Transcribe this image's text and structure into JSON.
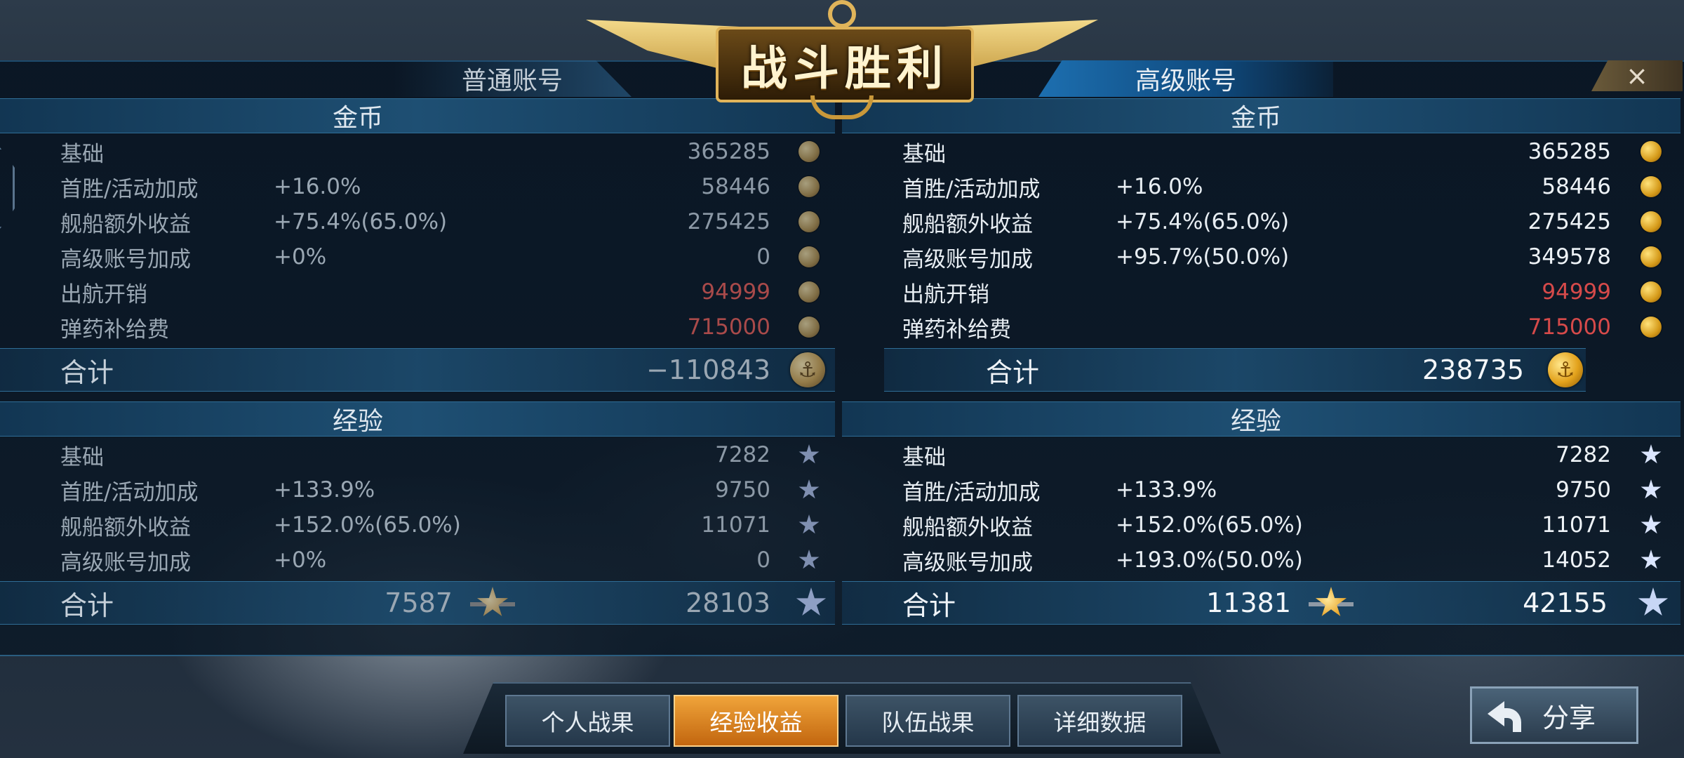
{
  "title": "战斗胜利",
  "close_glyph": "×",
  "normal": {
    "tab": "普通账号",
    "gold_header": "金币",
    "gold_rows": [
      {
        "label": "基础",
        "pct": "",
        "value": "365285"
      },
      {
        "label": "首胜/活动加成",
        "pct": "+16.0%",
        "value": "58446"
      },
      {
        "label": "舰船额外收益",
        "pct": "+75.4%(65.0%)",
        "value": "275425"
      },
      {
        "label": "高级账号加成",
        "pct": "+0%",
        "value": "0"
      },
      {
        "label": "出航开销",
        "pct": "",
        "value": "94999"
      },
      {
        "label": "弹药补给费",
        "pct": "",
        "value": "715000"
      }
    ],
    "gold_total_label": "合计",
    "gold_total": "−110843",
    "exp_header": "经验",
    "exp_rows": [
      {
        "label": "基础",
        "pct": "",
        "value": "7282"
      },
      {
        "label": "首胜/活动加成",
        "pct": "+133.9%",
        "value": "9750"
      },
      {
        "label": "舰船额外收益",
        "pct": "+152.0%(65.0%)",
        "value": "11071"
      },
      {
        "label": "高级账号加成",
        "pct": "+0%",
        "value": "0"
      }
    ],
    "exp_total_label": "合计",
    "exp_total_captain": "7587",
    "exp_total": "28103"
  },
  "premium": {
    "tab": "高级账号",
    "gold_header": "金币",
    "gold_rows": [
      {
        "label": "基础",
        "pct": "",
        "value": "365285"
      },
      {
        "label": "首胜/活动加成",
        "pct": "+16.0%",
        "value": "58446"
      },
      {
        "label": "舰船额外收益",
        "pct": "+75.4%(65.0%)",
        "value": "275425"
      },
      {
        "label": "高级账号加成",
        "pct": "+95.7%(50.0%)",
        "value": "349578"
      },
      {
        "label": "出航开销",
        "pct": "",
        "value": "94999"
      },
      {
        "label": "弹药补给费",
        "pct": "",
        "value": "715000"
      }
    ],
    "gold_total_label": "合计",
    "gold_total": "238735",
    "exp_header": "经验",
    "exp_rows": [
      {
        "label": "基础",
        "pct": "",
        "value": "7282"
      },
      {
        "label": "首胜/活动加成",
        "pct": "+133.9%",
        "value": "9750"
      },
      {
        "label": "舰船额外收益",
        "pct": "+152.0%(65.0%)",
        "value": "11071"
      },
      {
        "label": "高级账号加成",
        "pct": "+193.0%(50.0%)",
        "value": "14052"
      }
    ],
    "exp_total_label": "合计",
    "exp_total_captain": "11381",
    "exp_total": "42155"
  },
  "tabs": [
    {
      "label": "个人战果",
      "active": false
    },
    {
      "label": "经验收益",
      "active": true
    },
    {
      "label": "队伍战果",
      "active": false
    },
    {
      "label": "详细数据",
      "active": false
    }
  ],
  "share_label": "分享",
  "icons": {
    "coin": "gold-coin-icon",
    "star": "exp-star-icon",
    "captain": "captain-exp-star-icon"
  },
  "colors": {
    "cost_red": "#d64a4a",
    "active_tab": "#e08a24",
    "premium_tab": "#1d6fb0"
  }
}
